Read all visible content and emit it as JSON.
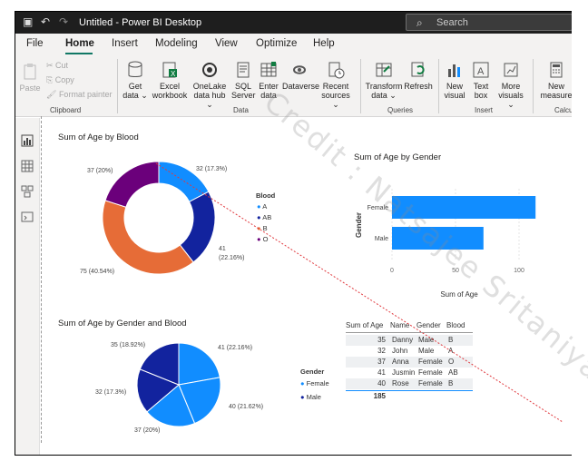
{
  "titlebar": {
    "title": "Untitled - Power BI Desktop",
    "search_placeholder": "Search"
  },
  "menu": {
    "items": [
      "File",
      "Home",
      "Insert",
      "Modeling",
      "View",
      "Optimize",
      "Help"
    ],
    "active": "Home"
  },
  "ribbon": {
    "clipboard": {
      "paste": "Paste",
      "cut": "Cut",
      "copy": "Copy",
      "format_painter": "Format painter",
      "group": "Clipboard"
    },
    "data": {
      "get_data": [
        "Get",
        "data ⌄"
      ],
      "excel": [
        "Excel",
        "workbook"
      ],
      "onelake": [
        "OneLake",
        "data hub ⌄"
      ],
      "sql": [
        "SQL",
        "Server"
      ],
      "enter": [
        "Enter",
        "data"
      ],
      "dataverse": "Dataverse",
      "recent": [
        "Recent",
        "sources ⌄"
      ],
      "group": "Data"
    },
    "queries": {
      "transform": [
        "Transform",
        "data ⌄"
      ],
      "refresh": "Refresh",
      "group": "Queries"
    },
    "insert": {
      "new_visual": [
        "New",
        "visual"
      ],
      "text_box": [
        "Text",
        "box"
      ],
      "more_visuals": [
        "More",
        "visuals ⌄"
      ],
      "group": "Insert"
    },
    "calc": {
      "new_measure": [
        "New",
        "measure"
      ],
      "group": "Calcu"
    }
  },
  "watermark": "Credit : Natsajee Sritaniyapakit",
  "colors": {
    "blue": "#118DFF",
    "navy": "#12239E",
    "orange": "#E66C37",
    "purple": "#6B007B",
    "accent": "#117865"
  },
  "chart_data": [
    {
      "type": "pie",
      "title": "Sum of Age by Blood",
      "donut": true,
      "legend_title": "Blood",
      "legend_placement": "right",
      "categories": [
        "A",
        "AB",
        "B",
        "O"
      ],
      "values": [
        32,
        41,
        75,
        37
      ],
      "data_labels": [
        "32 (17.3%)",
        "41 (22.16%)",
        "75 (40.54%)",
        "37 (20%)"
      ]
    },
    {
      "type": "bar",
      "title": "Sum of Age by Gender",
      "orientation": "horizontal",
      "categories": [
        "Female",
        "Male"
      ],
      "values": [
        113,
        72
      ],
      "xlabel": "Sum of Age",
      "ylabel": "Gender",
      "xticks": [
        "0",
        "50",
        "100"
      ],
      "xlim": [
        0,
        120
      ]
    },
    {
      "type": "pie",
      "title": "Sum of Age by Gender and Blood",
      "legend_title": "Gender",
      "legend_entries": [
        "Female",
        "Male"
      ],
      "legend_placement": "right",
      "slices": [
        {
          "gender": "Female",
          "blood": "AB",
          "value": 41,
          "label": "41 (22.16%)"
        },
        {
          "gender": "Female",
          "blood": "B",
          "value": 40,
          "label": "40 (21.62%)"
        },
        {
          "gender": "Female",
          "blood": "O",
          "value": 37,
          "label": "37 (20%)"
        },
        {
          "gender": "Male",
          "blood": "A",
          "value": 32,
          "label": "32 (17.3%)"
        },
        {
          "gender": "Male",
          "blood": "B",
          "value": 35,
          "label": "35 (18.92%)"
        }
      ]
    },
    {
      "type": "table",
      "columns": [
        "Sum of Age",
        "Name",
        "Gender",
        "Blood"
      ],
      "rows": [
        [
          "35",
          "Danny",
          "Male",
          "B"
        ],
        [
          "32",
          "John",
          "Male",
          "A"
        ],
        [
          "37",
          "Anna",
          "Female",
          "O"
        ],
        [
          "41",
          "Jusmin",
          "Female",
          "AB"
        ],
        [
          "40",
          "Rose",
          "Female",
          "B"
        ]
      ],
      "total": "185"
    }
  ]
}
